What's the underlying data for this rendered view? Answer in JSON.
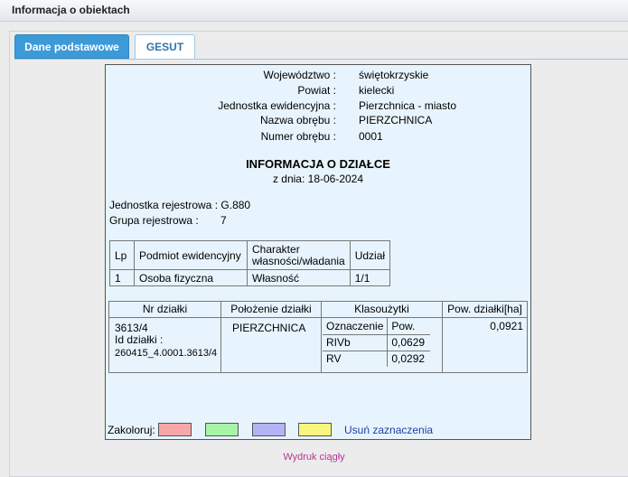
{
  "window": {
    "title": "Informacja o obiektach"
  },
  "tabs": [
    {
      "label": "Dane podstawowe",
      "active": true
    },
    {
      "label": "GESUT",
      "active": false
    }
  ],
  "location": [
    {
      "label": "Województwo :",
      "value": "świętokrzyskie"
    },
    {
      "label": "Powiat :",
      "value": "kielecki"
    },
    {
      "label": "Jednostka ewidencyjna :",
      "value": "Pierzchnica - miasto"
    },
    {
      "label": "Nazwa obrębu :",
      "value": "PIERZCHNICA"
    },
    {
      "label": "Numer obrębu :",
      "value": "0001"
    }
  ],
  "document": {
    "title": "INFORMACJA O DZIAŁCE",
    "date": "z dnia: 18-06-2024"
  },
  "registry": {
    "unit_label": "Jednostka rejestrowa :",
    "unit_value": "G.880",
    "group_label": "Grupa rejestrowa :",
    "group_value": "7"
  },
  "owners_table": {
    "headers": [
      "Lp",
      "Podmiot ewidencyjny",
      "Charakter własności/władania",
      "Udział"
    ],
    "rows": [
      [
        "1",
        "Osoba fizyczna",
        "Własność",
        "1/1"
      ]
    ]
  },
  "parcel_table": {
    "headers": [
      "Nr działki",
      "Położenie działki",
      "Klasoużytki",
      "Pow. działki[ha]"
    ],
    "parcel_no": "3613/4",
    "id_label": "Id działki :",
    "id_value": "260415_4.0001.3613/4",
    "location": "PIERZCHNICA",
    "area": "0,0921",
    "class_headers": [
      "Oznaczenie",
      "Pow."
    ],
    "classes": [
      [
        "RIVb",
        "0,0629"
      ],
      [
        "RV",
        "0,0292"
      ]
    ]
  },
  "colorize": {
    "label": "Zakoloruj:",
    "colors": [
      "#f7a7a7",
      "#a6f5a6",
      "#b3b3f5",
      "#f7f77f"
    ],
    "clear_label": "Usuń zaznaczenia"
  },
  "footer": {
    "print_link": "Wydruk ciągły"
  }
}
